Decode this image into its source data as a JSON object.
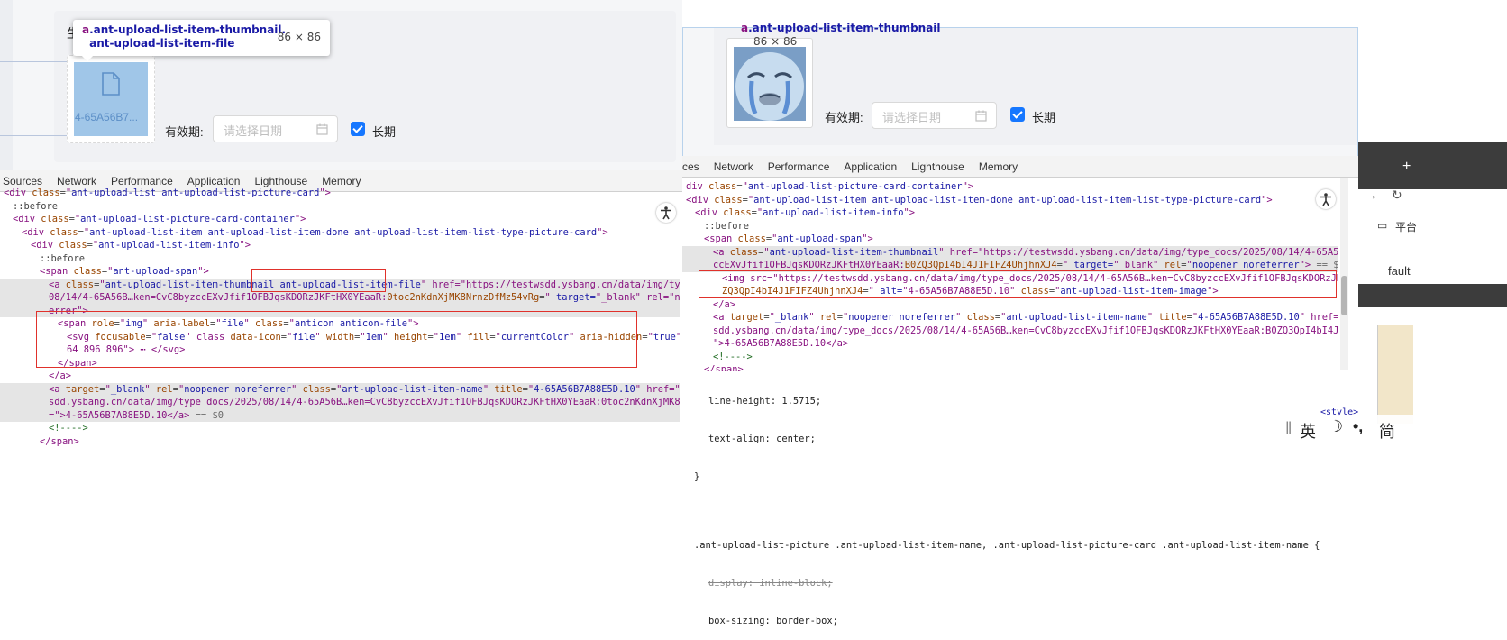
{
  "left": {
    "tooltip": {
      "tag": "a",
      "classes": ".ant-upload-list-item-thumbnail.ant-upload-list-item-file",
      "size": "86 × 86"
    },
    "partial_label": "生",
    "file_name": "4-65A56B7...",
    "validity_label": "有效期:",
    "date_placeholder": "请选择日期",
    "long_term_label": "长期",
    "devtools_tabs": [
      "Sources",
      "Network",
      "Performance",
      "Application",
      "Lighthouse",
      "Memory"
    ],
    "dom_lines": [
      {
        "indent": 0,
        "html": "<div class=\"ant-upload-list ant-upload-list-picture-card\">"
      },
      {
        "indent": 1,
        "html": "::before"
      },
      {
        "indent": 1,
        "html": "<div class=\"ant-upload-list-picture-card-container\">"
      },
      {
        "indent": 2,
        "html": "<div class=\"ant-upload-list-item ant-upload-list-item-done ant-upload-list-item-list-type-picture-card\">"
      },
      {
        "indent": 3,
        "html": "<div class=\"ant-upload-list-item-info\">"
      },
      {
        "indent": 4,
        "html": "::before"
      },
      {
        "indent": 4,
        "html": "<span class=\"ant-upload-span\">"
      },
      {
        "indent": 5,
        "html": "<a class=\"ant-upload-list-item-thumbnail ant-upload-list-item-file\" href=\"https://testwsdd.ysbang.cn/data/img/type_docs/2025/"
      },
      {
        "indent": 5,
        "html": "08/14/4-65A56B…ken=CvC8byzccEXvJfif1OFBJqsKDORzJKFtHX0YEaaR:0toc2nKdnXjMK8NrnzDfMz54vRg=\" target=\"_blank\" rel=\"noopener noref"
      },
      {
        "indent": 5,
        "html": "errer\">"
      },
      {
        "indent": 6,
        "html": "<span role=\"img\" aria-label=\"file\" class=\"anticon anticon-file\">"
      },
      {
        "indent": 7,
        "html": "<svg focusable=\"false\" class data-icon=\"file\" width=\"1em\" height=\"1em\" fill=\"currentColor\" aria-hidden=\"true\" viewBox=\"64"
      },
      {
        "indent": 7,
        "html": "64 896 896\"> ⋯ </svg>"
      },
      {
        "indent": 6,
        "html": "</span>"
      },
      {
        "indent": 5,
        "html": "</a>"
      },
      {
        "indent": 5,
        "html": "<a target=\"_blank\" rel=\"noopener noreferrer\" class=\"ant-upload-list-item-name\" title=\"4-65A56B7A88E5D.10\" href=\"https://testw"
      },
      {
        "indent": 5,
        "html": "sdd.ysbang.cn/data/img/type_docs/2025/08/14/4-65A56B…ken=CvC8byzccEXvJfif1OFBJqsKDORzJKFtHX0YEaaR:0toc2nKdnXjMK8NrnzDfMz54vRg"
      },
      {
        "indent": 5,
        "html": "=\">4-65A56B7A88E5D.10</a> == $0"
      },
      {
        "indent": 5,
        "html": "<!---->"
      },
      {
        "indent": 4,
        "html": "</span>"
      }
    ]
  },
  "right": {
    "tooltip": {
      "tag": "a",
      "classes": ".ant-upload-list-item-thumbnail",
      "size": "86 × 86"
    },
    "validity_label": "有效期:",
    "date_placeholder": "请选择日期",
    "long_term_label": "长期",
    "devtools_tabs": [
      "ces",
      "Network",
      "Performance",
      "Application",
      "Lighthouse",
      "Memory"
    ],
    "dom_lines": [
      {
        "indent": 0,
        "html": "div class=\"ant-upload-list-picture-card-container\">"
      },
      {
        "indent": 0,
        "html": "<div class=\"ant-upload-list-item ant-upload-list-item-done ant-upload-list-item-list-type-picture-card\">"
      },
      {
        "indent": 1,
        "html": "<div class=\"ant-upload-list-item-info\">"
      },
      {
        "indent": 2,
        "html": "::before"
      },
      {
        "indent": 2,
        "html": "<span class=\"ant-upload-span\">"
      },
      {
        "indent": 3,
        "html": "<a class=\"ant-upload-list-item-thumbnail\" href=\"https://testwsdd.ysbang.cn/data/img/type_docs/2025/08/14/4-65A56B…ken=CvC8byz"
      },
      {
        "indent": 3,
        "html": "ccEXvJfif1OFBJqsKDORzJKFtHX0YEaaR:B0ZQ3QpI4bI4J1FIFZ4UhjhnXJ4=\" target=\"_blank\" rel=\"noopener noreferrer\"> == $0"
      },
      {
        "indent": 4,
        "html": "<img src=\"https://testwsdd.ysbang.cn/data/img/type_docs/2025/08/14/4-65A56B…ken=CvC8byzccEXvJfif1OFBJqsKDORzJKFtHX0YEaaR:B0"
      },
      {
        "indent": 4,
        "html": "ZQ3QpI4bI4J1FIFZ4UhjhnXJ4=\" alt=\"4-65A56B7A88E5D.10\" class=\"ant-upload-list-item-image\">"
      },
      {
        "indent": 3,
        "html": "</a>"
      },
      {
        "indent": 3,
        "html": "<a target=\"_blank\" rel=\"noopener noreferrer\" class=\"ant-upload-list-item-name\" title=\"4-65A56B7A88E5D.10\" href=\"https://testw"
      },
      {
        "indent": 3,
        "html": "sdd.ysbang.cn/data/img/type_docs/2025/08/14/4-65A56B…ken=CvC8byzccEXvJfif1OFBJqsKDORzJKFtHX0YEaaR:B0ZQ3QpI4bI4J1FIFZ4UhjhnXJ4"
      },
      {
        "indent": 3,
        "html": "\">4-65A56B7A88E5D.10</a>"
      },
      {
        "indent": 3,
        "html": "<!---->"
      },
      {
        "indent": 2,
        "html": "</span>"
      }
    ],
    "styles": [
      "line-height: 1.5715;",
      "text-align: center;",
      "}",
      ".ant-upload-list-picture .ant-upload-list-item-name, .ant-upload-list-picture-card .ant-upload-list-item-name {",
      "display: inline-block;",
      "box-sizing: border-box;"
    ],
    "style_source": "<style>",
    "browser_snippets": {
      "folder_text": "平台",
      "default_text": "fault",
      "plus": "+"
    },
    "ime": {
      "lang": "英",
      "moon": "☽",
      "punct": "•,",
      "simp": "简"
    }
  }
}
